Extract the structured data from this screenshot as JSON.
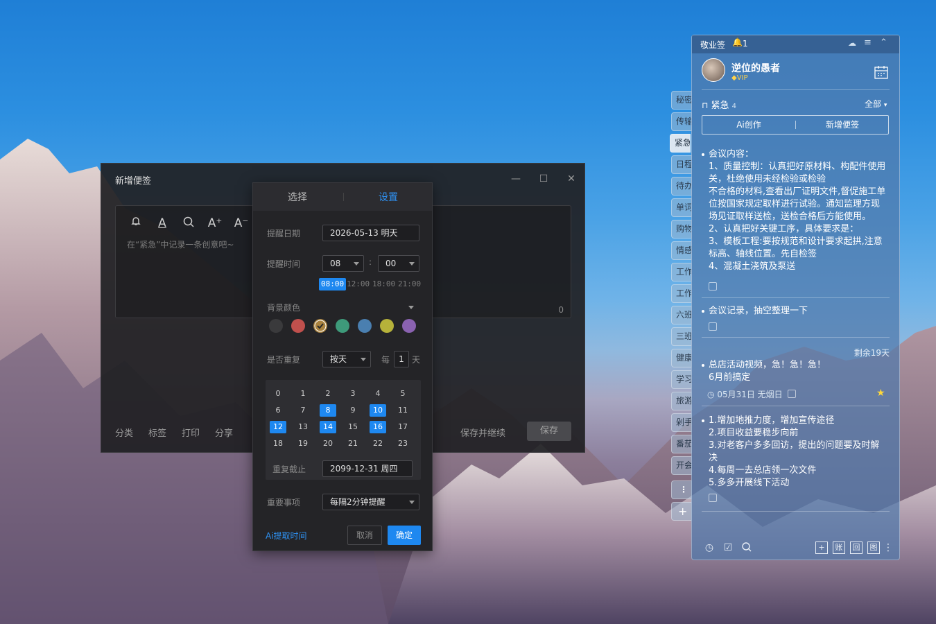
{
  "editor": {
    "title": "新增便签",
    "min": "—",
    "max": "☐",
    "close": "✕",
    "placeholder": "在“紧急”中记录一条创意吧~",
    "char_count": "0",
    "bottom": [
      "分类",
      "标签",
      "打印",
      "分享"
    ],
    "save_continue": "保存并继续",
    "save": "保存",
    "tools": {
      "bell": "🔔",
      "font": "A",
      "search": "🔍",
      "bigger": "A⁺",
      "smaller": "A⁻"
    }
  },
  "dialog": {
    "tab_select": "选择",
    "tab_settings": "设置",
    "remind_date_label": "提醒日期",
    "remind_date": "2026-05-13 明天",
    "remind_time_label": "提醒时间",
    "hour": "08",
    "minute": "00",
    "colon": ":",
    "quick_times": [
      "08:00",
      "12:00",
      "18:00",
      "21:00"
    ],
    "bg_color_label": "背景颜色",
    "colors": [
      "#3a3a3c",
      "#c0504d",
      "#a9823e",
      "#3e9a7a",
      "#4a7fb0",
      "#b6b23a",
      "#8a62b0"
    ],
    "repeat_label": "是否重复",
    "repeat_mode": "按天",
    "every": "每",
    "every_n": "1",
    "day_unit": "天",
    "hours": [
      "0",
      "1",
      "2",
      "3",
      "4",
      "5",
      "6",
      "7",
      "8",
      "9",
      "10",
      "11",
      "12",
      "13",
      "14",
      "15",
      "16",
      "17",
      "18",
      "19",
      "20",
      "21",
      "22",
      "23"
    ],
    "selected_hours": [
      "8",
      "10",
      "12",
      "14",
      "16"
    ],
    "repeat_until_label": "重复截止",
    "repeat_until": "2099-12-31 周四",
    "important_label": "重要事项",
    "important_value": "每隔2分钟提醒",
    "ai_extract": "Ai提取时间",
    "cancel": "取消",
    "ok": "确定"
  },
  "side_tabs": [
    "秘密",
    "传输",
    "紧急",
    "日程",
    "待办",
    "单词",
    "购物",
    "情感",
    "工作",
    "工作",
    "六班",
    "三班",
    "健康",
    "学习",
    "旅游",
    "剁手",
    "番茄",
    "开会"
  ],
  "panel": {
    "app_name": "敬业签",
    "bell_count": "1",
    "username": "逆位的愚者",
    "vip": "VIP",
    "category": "紧急",
    "category_count": "4",
    "filter": "全部",
    "ai_create": "Ai创作",
    "new_note": "新增便签",
    "notes": [
      {
        "text": "会议内容：\n1、质量控制：认真把好原材料、构配件使用关，杜绝使用未经检验或检验\n不合格的材料,查看出厂证明文件,督促施工单位按国家规定取样进行试验。通知监理方现场见证取样送检，送检合格后方能使用。\n2、认真把好关键工序，具体要求是：\n3、模板工程:要按规范和设计要求起拱,注意标高、轴线位置。先自检签\n4、混凝土浇筑及泵送"
      },
      {
        "text": "会议记录，抽空整理一下"
      },
      {
        "remaining": "剩余19天",
        "text": "总店活动视频，急！急！急！\n6月前搞定",
        "date": "05月31日 无烟日"
      },
      {
        "text": "1.增加地推力度，增加宣传途径\n2.项目收益要稳步向前\n3.对老客户多多回访，提出的问题要及时解决\n4.每周一去总店领一次文件\n5.多多开展线下活动"
      }
    ]
  }
}
